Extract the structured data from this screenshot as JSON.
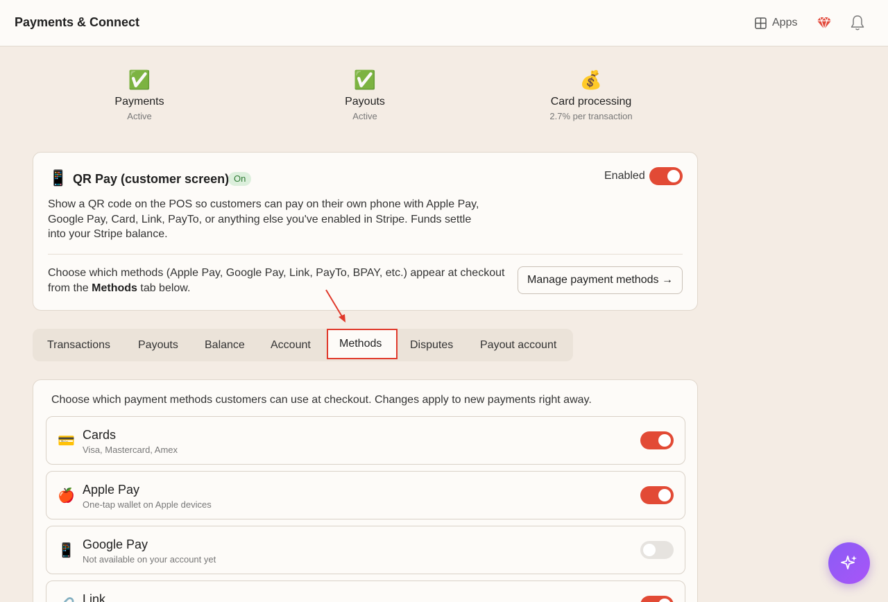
{
  "header": {
    "title": "Payments & Connect",
    "apps_label": "Apps",
    "icons": [
      "apps-grid-icon",
      "gem-icon",
      "bell-icon"
    ]
  },
  "stats": [
    {
      "emoji": "✅",
      "title": "Payments",
      "sub": "Active"
    },
    {
      "emoji": "✅",
      "title": "Payouts",
      "sub": "Active"
    },
    {
      "emoji": "💰",
      "title": "Card processing",
      "sub": "2.7% per transaction"
    }
  ],
  "qr": {
    "icon": "📱",
    "title": "QR Pay (customer screen)",
    "badge": "On",
    "enabled_label": "Enabled",
    "enabled": true,
    "description": "Show a QR code on the POS so customers can pay on their own phone with Apple Pay, Google Pay, Card, Link, PayTo, or anything else you've enabled in Stripe. Funds settle into your Stripe balance.",
    "choose_prefix": "Choose which methods (Apple Pay, Google Pay, Link, PayTo, BPAY, etc.) appear at checkout from the ",
    "choose_bold": "Methods",
    "choose_suffix": " tab below.",
    "manage_button": "Manage payment methods →"
  },
  "tabs": [
    {
      "label": "Transactions"
    },
    {
      "label": "Payouts"
    },
    {
      "label": "Balance"
    },
    {
      "label": "Account"
    },
    {
      "label": "Methods",
      "active": true
    },
    {
      "label": "Disputes"
    },
    {
      "label": "Payout account"
    }
  ],
  "methods": {
    "intro": "Choose which payment methods customers can use at checkout. Changes apply to new payments right away.",
    "items": [
      {
        "icon": "💳",
        "name": "Cards",
        "sub": "Visa, Mastercard, Amex",
        "enabled": true
      },
      {
        "icon": "🍎",
        "name": "Apple Pay",
        "sub": "One-tap wallet on Apple devices",
        "enabled": true
      },
      {
        "icon": "📱",
        "name": "Google Pay",
        "sub": "Not available on your account yet",
        "enabled": false
      },
      {
        "icon": "🔗",
        "name": "Link",
        "sub": "",
        "enabled": true
      }
    ]
  },
  "colors": {
    "accent": "#e24a35",
    "highlight": "#e0392b",
    "background": "#f4ece4",
    "fab": "#9b59f0"
  }
}
